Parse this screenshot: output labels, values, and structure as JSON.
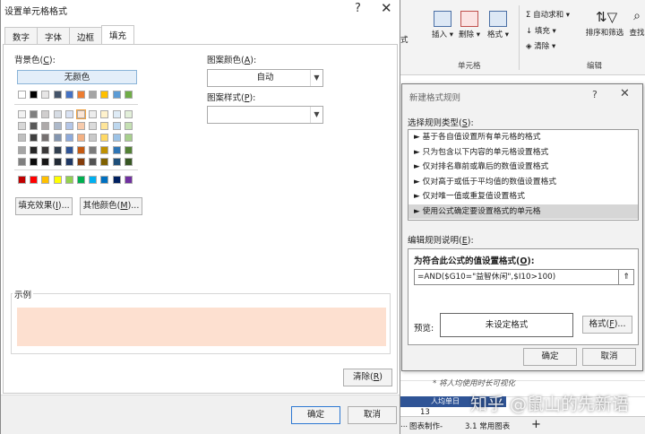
{
  "excel": {
    "ribbon": {
      "buttons": [
        {
          "label": "插入",
          "icon": "insert-cells-icon"
        },
        {
          "label": "删除",
          "icon": "delete-cells-icon"
        },
        {
          "label": "格式",
          "icon": "format-cells-icon"
        }
      ],
      "partial_left": "式",
      "cells_group": "单元格",
      "editing_group": "编辑",
      "autosum": "自动求和",
      "fill": "填充",
      "clear": "清除",
      "sort_filter": "排序和筛选",
      "find_partial": "查找"
    },
    "note": "* 将人均使用时长可视化",
    "cell_header": "人均单日",
    "row_number": "13",
    "sheet_tabs": [
      "图表制作-",
      "3.1 常用图表"
    ],
    "tab_more": "...",
    "add_sheet": "+",
    "watermark": "知乎 @鼠山的先新语"
  },
  "format_dialog": {
    "title": "设置单元格格式",
    "help": "?",
    "close": "✕",
    "tabs": [
      "数字",
      "字体",
      "边框",
      "填充"
    ],
    "active_tab": "填充",
    "bg_color_label": "背景色(",
    "bg_color_key": "C",
    "no_color": "无颜色",
    "pattern_color_label": "图案颜色(",
    "pattern_color_key": "A",
    "pattern_color_value": "自动",
    "pattern_style_label": "图案样式(",
    "pattern_style_key": "P",
    "pattern_style_value": "",
    "fill_effects": "填充效果(",
    "fill_effects_key": "I",
    "more_colors": "其他颜色(",
    "more_colors_key": "M",
    "ellipsis_close": ")...",
    "close_paren": ")",
    "sample_label": "示例",
    "sample_color": "#fde0d0",
    "clear": "清除(",
    "clear_key": "R",
    "ok": "确定",
    "cancel": "取消",
    "theme_row": [
      "#ffffff",
      "#000000",
      "#e7e6e6",
      "#44546a",
      "#4472c4",
      "#ed7d31",
      "#a5a5a5",
      "#ffc000",
      "#5b9bd5",
      "#70ad47"
    ],
    "theme_shades": [
      [
        "#f2f2f2",
        "#7f7f7f",
        "#d0cece",
        "#d6dce4",
        "#d9e2f3",
        "#fbe5d5",
        "#ededed",
        "#fff2cc",
        "#deebf6",
        "#e2efd9"
      ],
      [
        "#d8d8d8",
        "#595959",
        "#aeaaaa",
        "#adb9ca",
        "#b4c6e7",
        "#f7cbac",
        "#dbdbdb",
        "#fee599",
        "#bdd7ee",
        "#c5e0b3"
      ],
      [
        "#bfbfbf",
        "#3f3f3f",
        "#757070",
        "#8496b0",
        "#8eaadb",
        "#f4b183",
        "#c9c9c9",
        "#ffd965",
        "#9dc3e6",
        "#a8d08d"
      ],
      [
        "#a5a5a5",
        "#262626",
        "#3a3838",
        "#323f4f",
        "#2f5496",
        "#c55a11",
        "#7b7b7b",
        "#bf9000",
        "#2e75b5",
        "#538135"
      ],
      [
        "#7f7f7f",
        "#0c0c0c",
        "#171616",
        "#222a35",
        "#1f3864",
        "#833c0b",
        "#525252",
        "#7f6000",
        "#1e4e79",
        "#375623"
      ]
    ],
    "standard_row": [
      "#c00000",
      "#ff0000",
      "#ffc000",
      "#ffff00",
      "#92d050",
      "#00b050",
      "#00b0f0",
      "#0070c0",
      "#002060",
      "#7030a0"
    ]
  },
  "new_rule_dialog": {
    "title": "新建格式规则",
    "help": "?",
    "close": "✕",
    "select_label": "选择规则类型(",
    "select_key": "S",
    "rule_types": [
      "► 基于各自值设置所有单元格的格式",
      "► 只为包含以下内容的单元格设置格式",
      "► 仅对排名靠前或靠后的数值设置格式",
      "► 仅对高于或低于平均值的数值设置格式",
      "► 仅对唯一值或重复值设置格式",
      "► 使用公式确定要设置格式的单元格"
    ],
    "selected_index": 5,
    "edit_label": "编辑规则说明(",
    "edit_key": "E",
    "formula_label": "为符合此公式的值设置格式(",
    "formula_key": "O",
    "formula_value": "=AND($G10=\"益智休闲\",$I10>100)",
    "preview_label": "预览:",
    "preview_text": "未设定格式",
    "format_button": "格式(",
    "format_key": "F",
    "ok": "确定",
    "cancel": "取消"
  }
}
